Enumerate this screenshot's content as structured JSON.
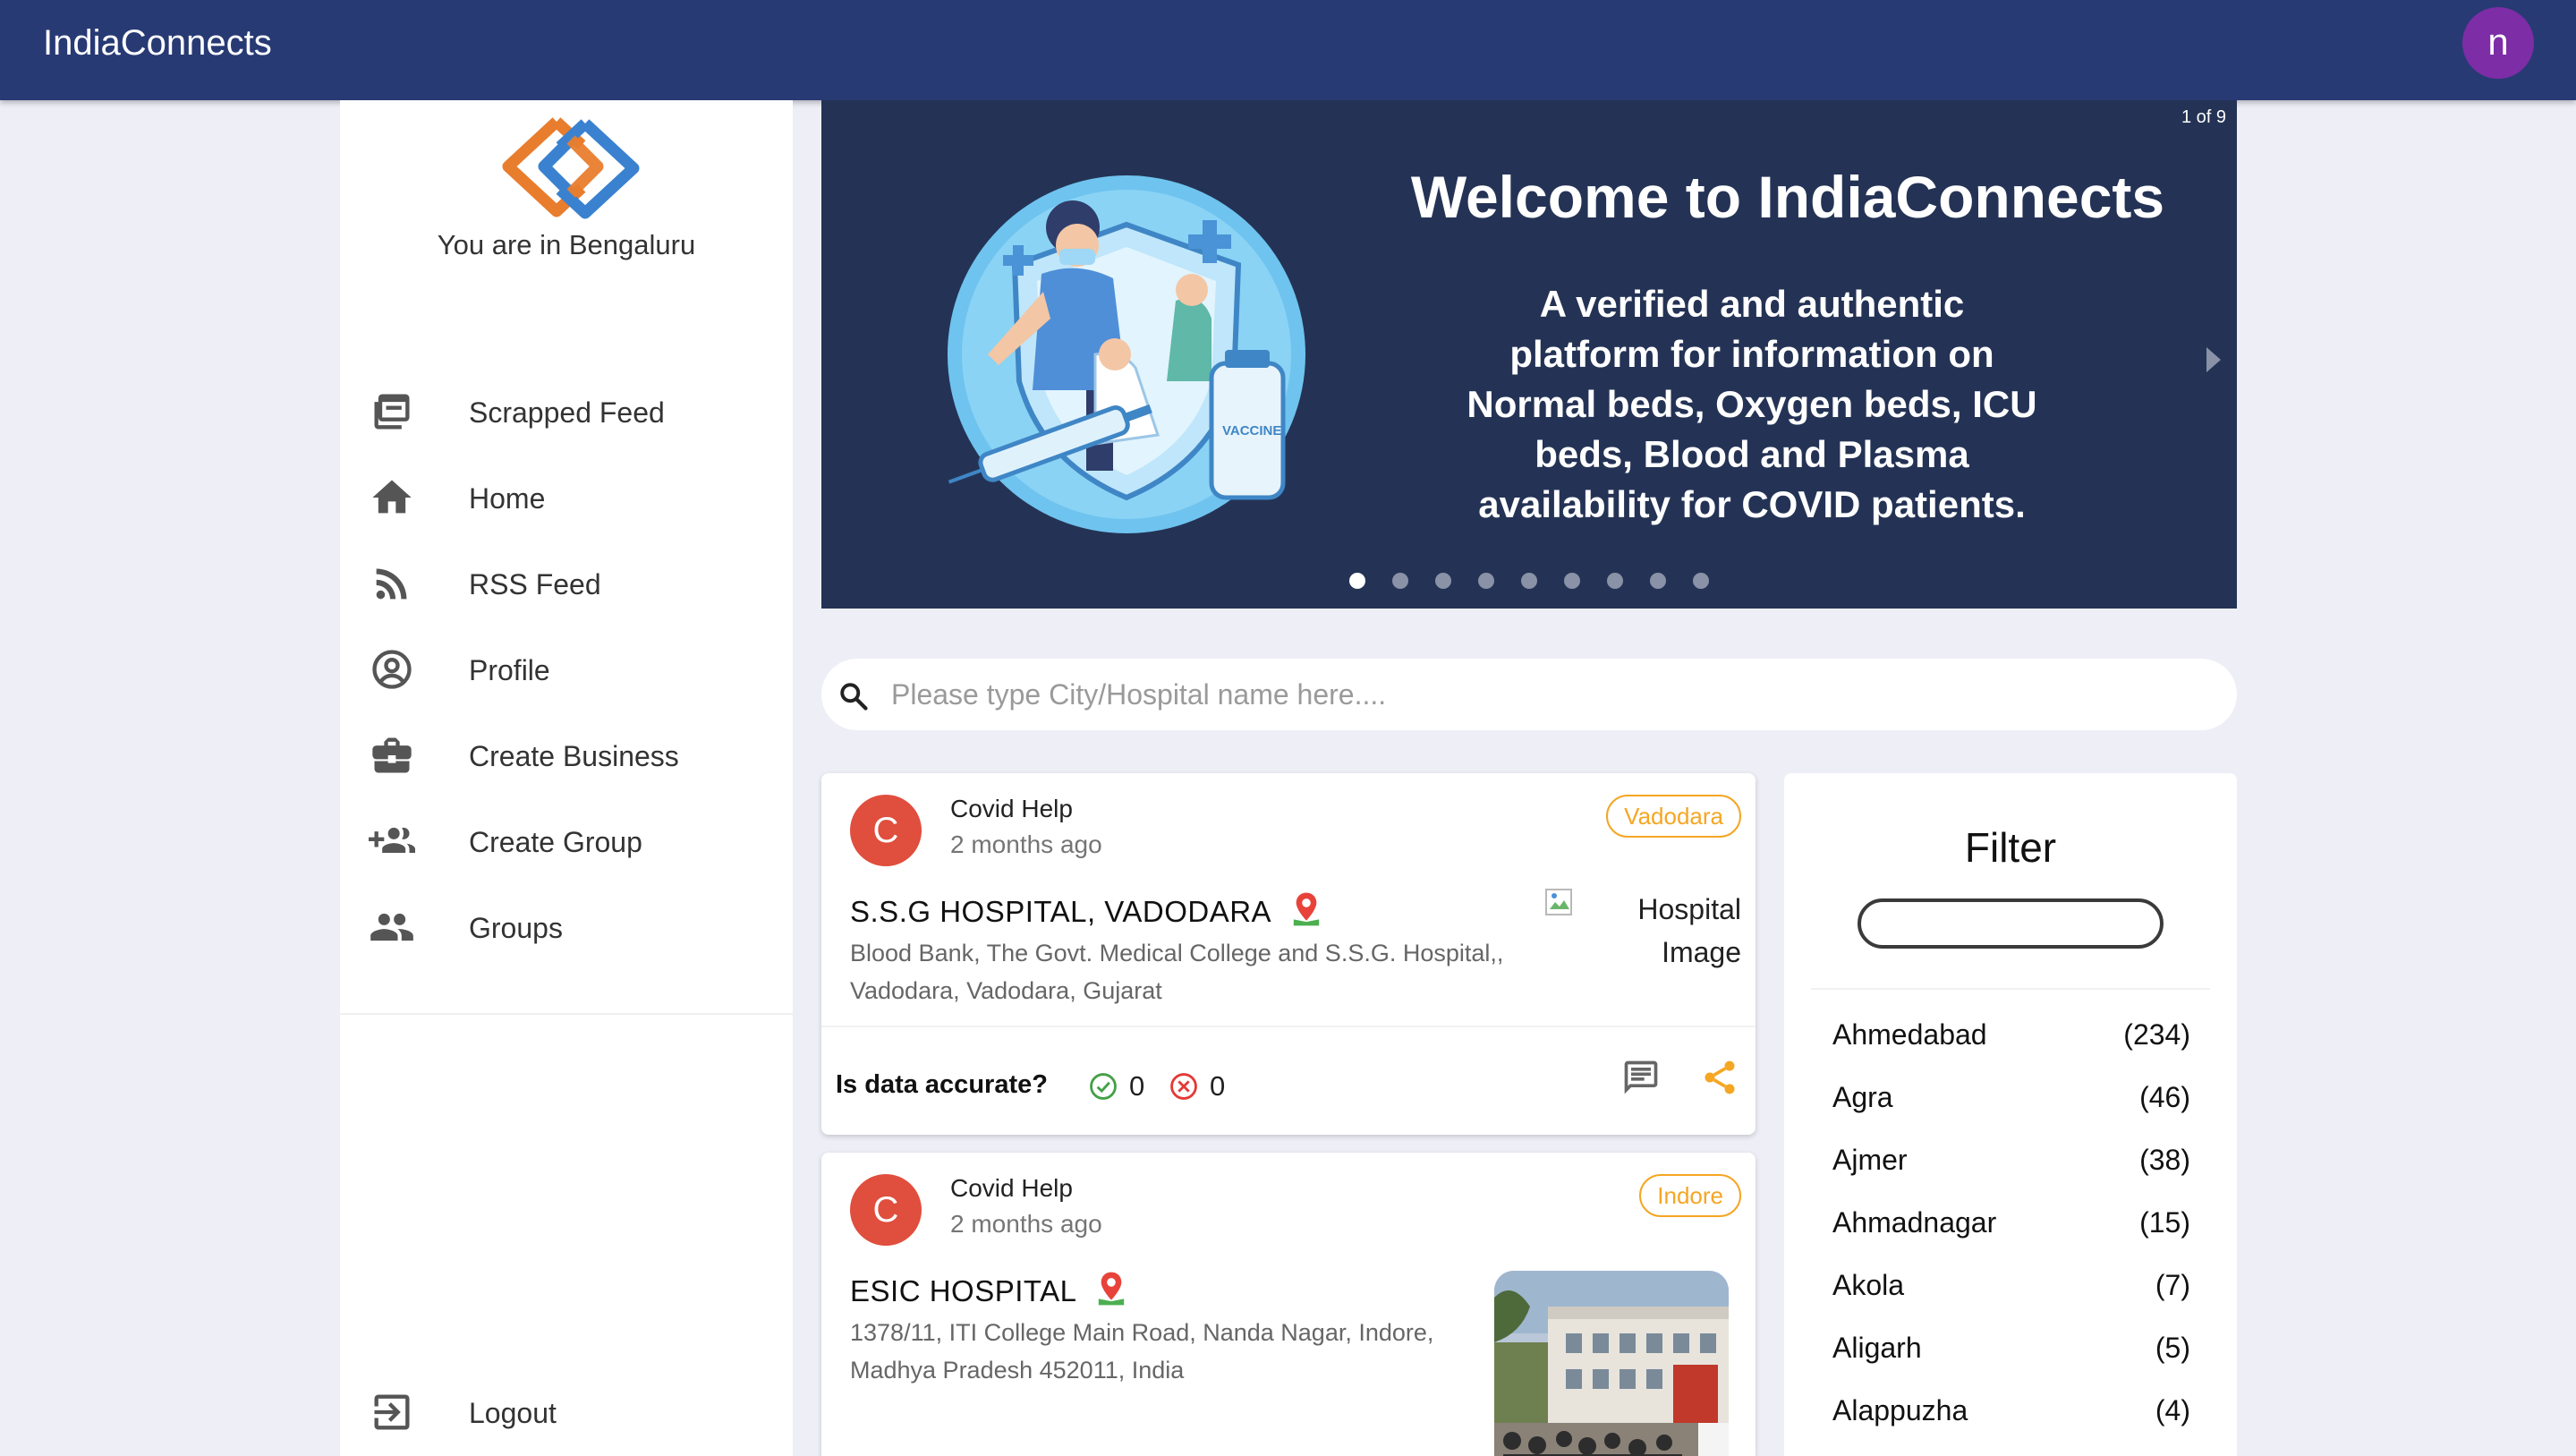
{
  "app": {
    "title": "IndiaConnects",
    "user_initial": "n"
  },
  "sidebar": {
    "location_text": "You are in Bengaluru",
    "items": [
      {
        "label": "Scrapped Feed",
        "icon": "feed-icon"
      },
      {
        "label": "Home",
        "icon": "home-icon"
      },
      {
        "label": "RSS Feed",
        "icon": "rss-icon"
      },
      {
        "label": "Profile",
        "icon": "profile-icon"
      },
      {
        "label": "Create Business",
        "icon": "briefcase-icon"
      },
      {
        "label": "Create Group",
        "icon": "add-group-icon"
      },
      {
        "label": "Groups",
        "icon": "groups-icon"
      }
    ],
    "logout_label": "Logout"
  },
  "carousel": {
    "counter": "1 of 9",
    "title": "Welcome to IndiaConnects",
    "body_lines": [
      "A verified and authentic",
      "platform for information on",
      "Normal beds, Oxygen beds, ICU",
      "beds, Blood and Plasma",
      "availability for COVID patients."
    ],
    "vaccine_label": "VACCINE",
    "slide_count": 9,
    "active_slide": 1
  },
  "search": {
    "placeholder": "Please type City/Hospital name here...."
  },
  "cards": [
    {
      "avatar": "C",
      "author": "Covid Help",
      "time": "2 months ago",
      "city": "Vadodara",
      "hospital": "S.S.G HOSPITAL, VADODARA",
      "address_lines": [
        "Blood Bank, The Govt. Medical College and S.S.G. Hospital,,",
        "Vadodara, Vadodara, Gujarat"
      ],
      "image_alt_lines": [
        "Hospital",
        "Image"
      ],
      "accuracy_label": "Is data accurate?",
      "yes_votes": "0",
      "no_votes": "0"
    },
    {
      "avatar": "C",
      "author": "Covid Help",
      "time": "2 months ago",
      "city": "Indore",
      "hospital": "ESIC HOSPITAL",
      "address_lines": [
        "1378/11, ITI College Main Road, Nanda Nagar, Indore,",
        "Madhya Pradesh 452011, India"
      ]
    }
  ],
  "filter": {
    "title": "Filter",
    "cities": [
      {
        "name": "Ahmedabad",
        "count": "(234)"
      },
      {
        "name": "Agra",
        "count": "(46)"
      },
      {
        "name": "Ajmer",
        "count": "(38)"
      },
      {
        "name": "Ahmadnagar",
        "count": "(15)"
      },
      {
        "name": "Akola",
        "count": "(7)"
      },
      {
        "name": "Aligarh",
        "count": "(5)"
      },
      {
        "name": "Alappuzha",
        "count": "(4)"
      }
    ]
  },
  "colors": {
    "topbar": "#283a74",
    "carousel_bg": "#243355",
    "page_bg": "#eeeef7",
    "avatar_user": "#7d2da6",
    "avatar_post": "#e04e3d",
    "tag_accent": "#f5a623",
    "vote_yes": "#43a047",
    "vote_no": "#e53935"
  }
}
